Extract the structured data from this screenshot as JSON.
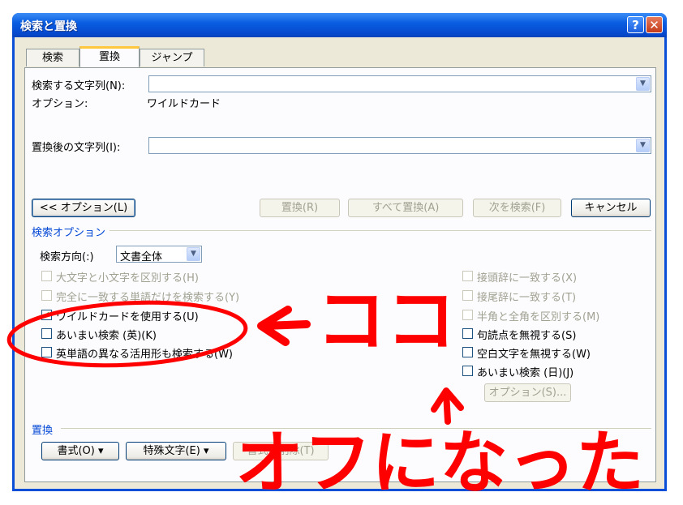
{
  "window": {
    "title": "検索と置換"
  },
  "title_buttons": {
    "help": "?",
    "close": "✕"
  },
  "tabs": [
    {
      "label": "検索",
      "active": false
    },
    {
      "label": "置換",
      "active": true
    },
    {
      "label": "ジャンプ",
      "active": false
    }
  ],
  "find": {
    "label": "検索する文字列(N):",
    "value": "",
    "option_label": "オプション:",
    "option_value": "ワイルドカード"
  },
  "replace": {
    "label": "置換後の文字列(I):",
    "value": ""
  },
  "buttons": {
    "options": "<< オプション(L)",
    "replace": "置換(R)",
    "replace_all": "すべて置換(A)",
    "find_next": "次を検索(F)",
    "cancel": "キャンセル"
  },
  "search_options": {
    "group_label": "検索オプション",
    "direction_label": "検索方向(:)",
    "direction_value": "文書全体",
    "left_checkboxes": [
      {
        "label": "大文字と小文字を区別する(H)",
        "checked": false,
        "enabled": false
      },
      {
        "label": "完全に一致する単語だけを検索する(Y)",
        "checked": false,
        "enabled": false
      },
      {
        "label": "ワイルドカードを使用する(U)",
        "checked": true,
        "enabled": true
      },
      {
        "label": "あいまい検索 (英)(K)",
        "checked": false,
        "enabled": true
      },
      {
        "label": "英単語の異なる活用形も検索する(W)",
        "checked": false,
        "enabled": true
      }
    ],
    "right_checkboxes": [
      {
        "label": "接頭辞に一致する(X)",
        "checked": false,
        "enabled": false
      },
      {
        "label": "接尾辞に一致する(T)",
        "checked": false,
        "enabled": false
      },
      {
        "label": "半角と全角を区別する(M)",
        "checked": false,
        "enabled": false
      },
      {
        "label": "句読点を無視する(S)",
        "checked": false,
        "enabled": true
      },
      {
        "label": "空白文字を無視する(W)",
        "checked": false,
        "enabled": true
      },
      {
        "label": "あいまい検索 (日)(J)",
        "checked": false,
        "enabled": true
      }
    ],
    "fuzzy_options_button": "オプション(S)..."
  },
  "replace_section": {
    "group_label": "置換",
    "format_button": "書式(O) ▾",
    "special_button": "特殊文字(E) ▾",
    "remove_format_button": "書式の削除(T)"
  },
  "annotations": {
    "arrow_text": "ココ",
    "bottom_text": "オフになった",
    "color": "#ff0000"
  }
}
